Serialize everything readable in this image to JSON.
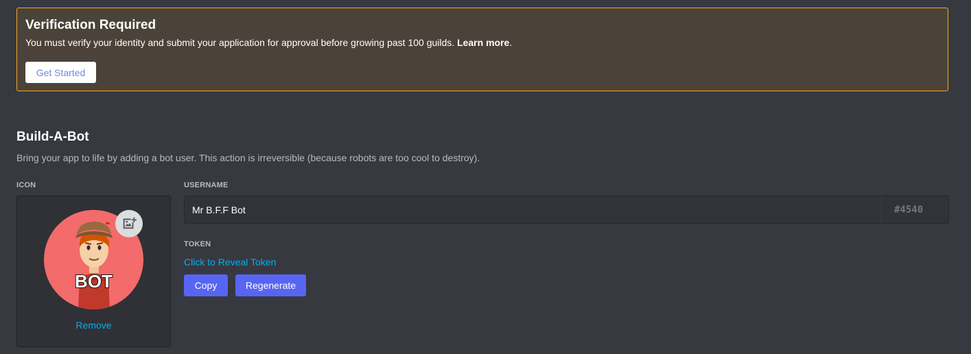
{
  "verification": {
    "title": "Verification Required",
    "message": "You must verify your identity and submit your application for approval before growing past 100 guilds.",
    "learn_more": "Learn more",
    "period": ".",
    "button_label": "Get Started"
  },
  "bot_section": {
    "title": "Build-A-Bot",
    "description": "Bring your app to life by adding a bot user. This action is irreversible (because robots are too cool to destroy).",
    "icon_label": "ICON",
    "avatar_text": "BOT",
    "remove_label": "Remove",
    "username_label": "USERNAME",
    "username_value": "Mr B.F.F Bot",
    "discriminator": "#4540",
    "token_label": "TOKEN",
    "reveal_token": "Click to Reveal Token",
    "copy_label": "Copy",
    "regenerate_label": "Regenerate"
  },
  "colors": {
    "background": "#36393f",
    "warning_border": "#faa61a",
    "link": "#00b0f4",
    "blurple": "#5865f2",
    "avatar_bg": "#f36b6b"
  },
  "icons": {
    "upload": "image-add-icon"
  }
}
